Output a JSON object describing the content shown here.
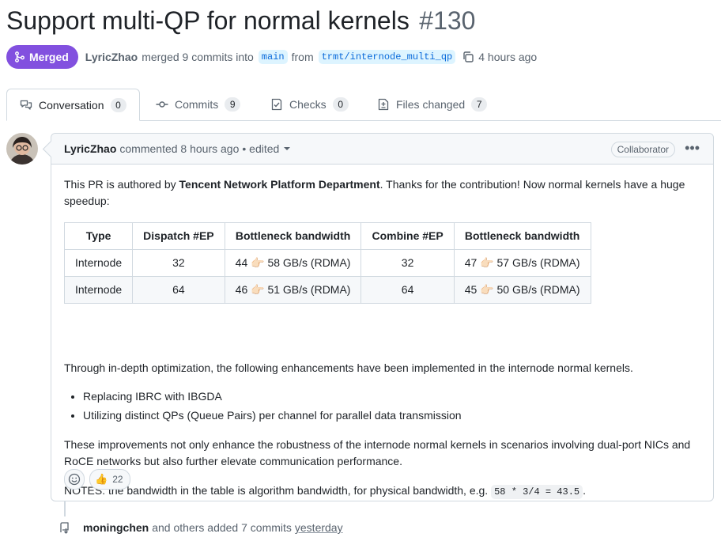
{
  "pr": {
    "title": "Support multi-QP for normal kernels",
    "number": "#130",
    "status": "Merged",
    "author": "LyricZhao",
    "merge_text_1": "merged 9 commits into",
    "base_branch": "main",
    "merge_text_2": "from",
    "head_branch": "trmt/internode_multi_qp",
    "time": "4 hours ago"
  },
  "tabs": [
    {
      "label": "Conversation",
      "count": "0",
      "icon": "conversation-icon",
      "active": true
    },
    {
      "label": "Commits",
      "count": "9",
      "icon": "commit-icon"
    },
    {
      "label": "Checks",
      "count": "0",
      "icon": "checklist-icon"
    },
    {
      "label": "Files changed",
      "count": "7",
      "icon": "file-diff-icon"
    }
  ],
  "comment": {
    "author": "LyricZhao",
    "action": "commented 8 hours ago",
    "edited": "• edited",
    "role": "Collaborator",
    "intro_1": "This PR is authored by ",
    "intro_bold": "Tencent Network Platform Department",
    "intro_2": ". Thanks for the contribution! Now normal kernels have a huge speedup:",
    "table": {
      "headers": [
        "Type",
        "Dispatch #EP",
        "Bottleneck bandwidth",
        "Combine #EP",
        "Bottleneck bandwidth"
      ],
      "rows": [
        [
          "Internode",
          "32",
          "44",
          "58 GB/s (RDMA)",
          "32",
          "47",
          "57 GB/s (RDMA)"
        ],
        [
          "Internode",
          "64",
          "46",
          "51 GB/s (RDMA)",
          "64",
          "45",
          "50 GB/s (RDMA)"
        ]
      ],
      "arrow_emoji": "👉🏻"
    },
    "paragraph_2": "Through in-depth optimization, the following enhancements have been implemented in the internode normal kernels.",
    "bullets": [
      "Replacing IBRC with IBGDA",
      "Utilizing distinct QPs (Queue Pairs) per channel for parallel data transmission"
    ],
    "paragraph_3": "These improvements not only enhance the robustness of the internode normal kernels in scenarios involving dual-port NICs and RoCE networks but also further elevate communication performance.",
    "notes_prefix": "NOTES: the bandwidth in the table is algorithm bandwidth, for physical bandwidth, e.g. ",
    "notes_code": "58 * 3/4 = 43.5",
    "notes_suffix": ".",
    "reactions": [
      {
        "emoji": "👍",
        "count": "22"
      }
    ]
  },
  "timeline": {
    "user": "moningchen",
    "text": "and others added 7 commits",
    "time": "yesterday"
  },
  "colors": {
    "merged": "#8250df",
    "link": "#0969da",
    "border": "#d1d9e0"
  }
}
